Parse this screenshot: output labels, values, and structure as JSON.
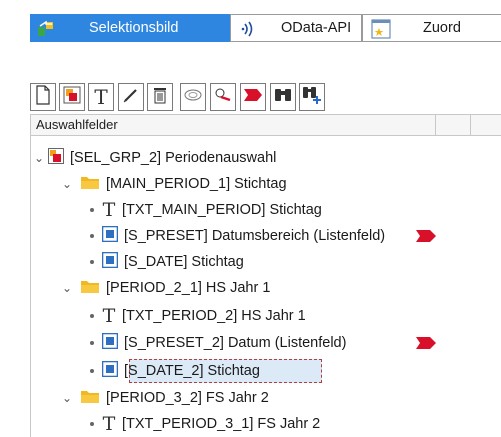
{
  "tabs": [
    {
      "label": "Selektionsbild",
      "icon": "transfer-icon",
      "active": true
    },
    {
      "label": "OData-API",
      "icon": "broadcast-icon",
      "active": false
    },
    {
      "label": "Zuord",
      "icon": "star-window-icon",
      "active": false
    }
  ],
  "toolbar": {
    "buttons": [
      "new-document-icon",
      "group-icon",
      "text-icon",
      "edit-pencil-icon",
      "delete-trash-icon",
      "speech-bubble-icon",
      "no-entry-icon",
      "flag-icon",
      "binoculars-icon",
      "find-add-icon"
    ]
  },
  "tree": {
    "header": "Auswahlfelder",
    "rows": [
      {
        "label": "[SEL_GRP_2] Periodenauswahl",
        "icon": "group-icon",
        "expand": "expanded"
      },
      {
        "label": "[MAIN_PERIOD_1] Stichtag",
        "icon": "folder-icon",
        "expand": "expanded"
      },
      {
        "label": "[TXT_MAIN_PERIOD] Stichtag",
        "icon": "text-icon",
        "expand": "leaf"
      },
      {
        "label": "[S_PRESET] Datumsbereich (Listenfeld)",
        "icon": "field-icon",
        "expand": "leaf",
        "flag": true
      },
      {
        "label": "[S_DATE] Stichtag",
        "icon": "field-icon",
        "expand": "leaf"
      },
      {
        "label": "[PERIOD_2_1] HS Jahr 1",
        "icon": "folder-icon",
        "expand": "expanded"
      },
      {
        "label": "[TXT_PERIOD_2] HS Jahr 1",
        "icon": "text-icon",
        "expand": "leaf"
      },
      {
        "label": "[S_PRESET_2] Datum (Listenfeld)",
        "icon": "field-icon",
        "expand": "leaf",
        "flag": true
      },
      {
        "label": "[S_DATE_2] Stichtag",
        "icon": "field-icon",
        "expand": "leaf",
        "selected": true
      },
      {
        "label": "[PERIOD_3_2] FS Jahr 2",
        "icon": "folder-icon",
        "expand": "expanded"
      },
      {
        "label": "[TXT_PERIOD_3_1] FS Jahr 2",
        "icon": "text-icon",
        "expand": "leaf"
      }
    ]
  },
  "colors": {
    "accent": "#2e86e0",
    "selection": "#dceaf7",
    "flag": "#d8102a",
    "folder": "#f2b81f"
  }
}
